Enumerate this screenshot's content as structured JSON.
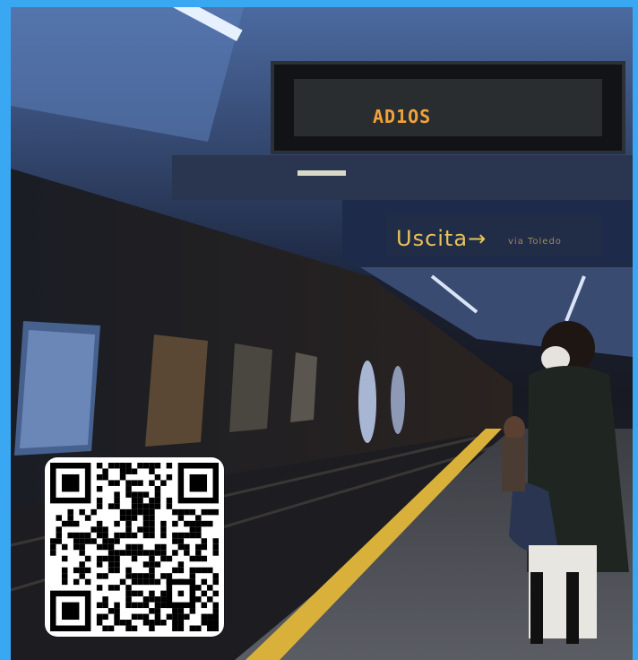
{
  "scene": {
    "board_text": "AD1OS",
    "exit_sign": {
      "label": "Uscita",
      "arrow": "→",
      "sub": "via Toledo"
    }
  },
  "qr": {
    "icon": "qr-code-icon"
  },
  "colors": {
    "frame": "#3aa7f2",
    "led": "#f2a23a",
    "platform_line": "#d9b13a"
  }
}
